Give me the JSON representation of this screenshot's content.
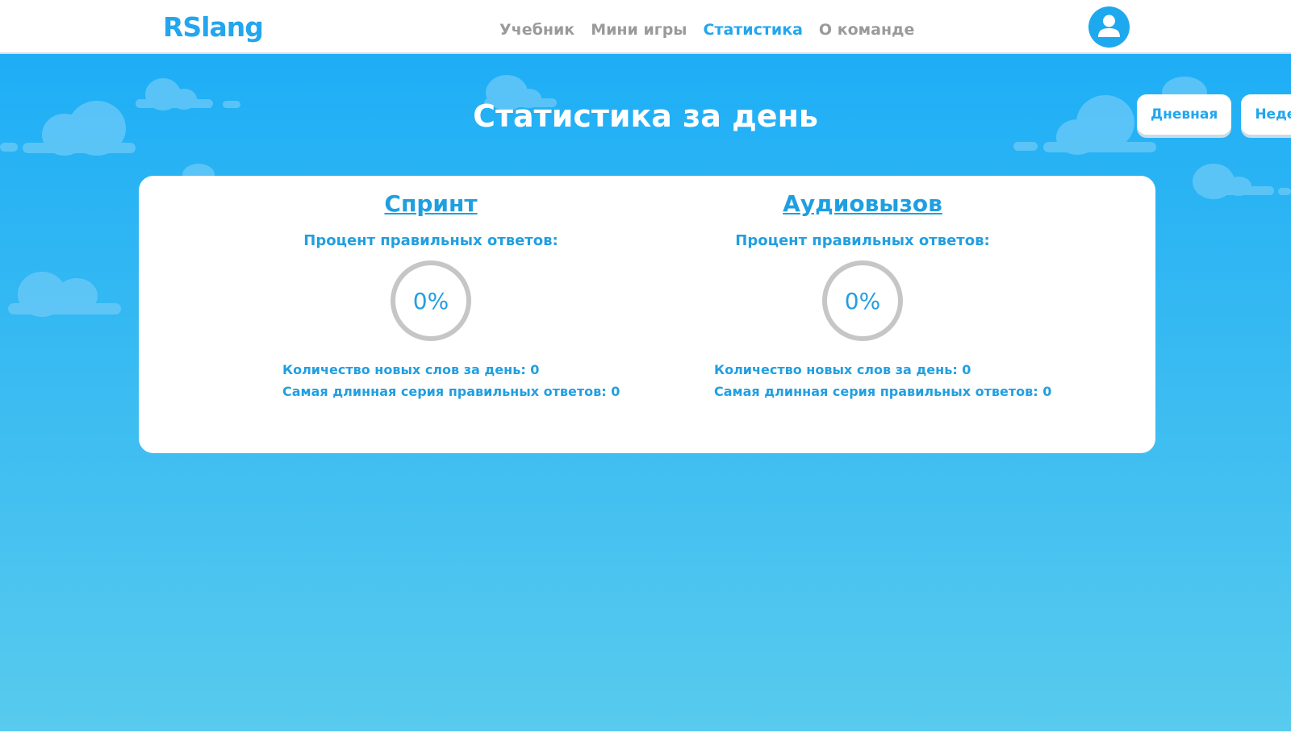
{
  "header": {
    "logo": "RSlang",
    "nav": [
      {
        "label": "Учебник",
        "active": false
      },
      {
        "label": "Мини игры",
        "active": false
      },
      {
        "label": "Статистика",
        "active": true
      },
      {
        "label": "О команде",
        "active": false
      }
    ],
    "avatar_icon": "user-icon"
  },
  "page": {
    "title": "Статистика за день",
    "period_tabs": [
      "Дневная",
      "Недел"
    ]
  },
  "games": [
    {
      "title": "Спринт",
      "percent_label": "Процент правильных ответов:",
      "percent": "0%",
      "new_words": "Количество новых слов за день: 0",
      "longest_series": "Самая длинная серия правильных ответов: 0"
    },
    {
      "title": "Аудиовызов",
      "percent_label": "Процент правильных ответов:",
      "percent": "0%",
      "new_words": "Количество новых слов за день: 0",
      "longest_series": "Самая длинная серия правильных ответов: 0"
    }
  ],
  "colors": {
    "accent": "#22a6ee",
    "nav_inactive": "#9a9a9a",
    "ring": "#c6c6c6"
  }
}
